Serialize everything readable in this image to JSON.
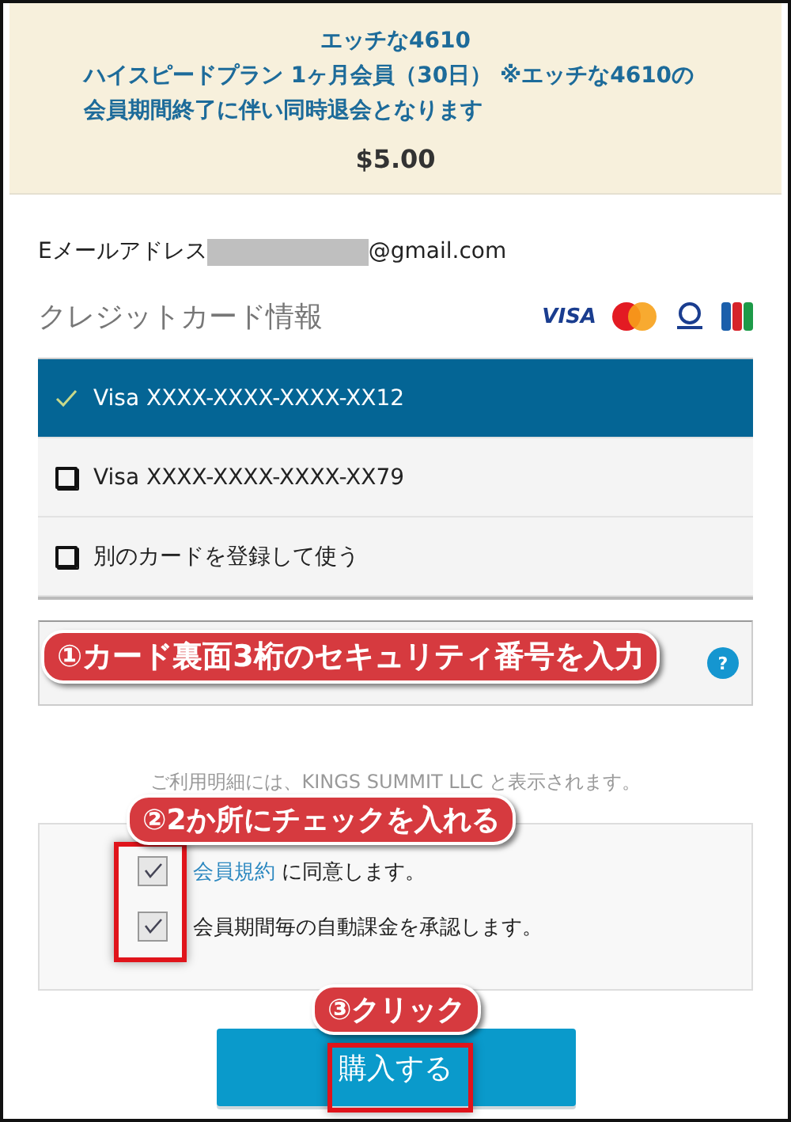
{
  "plan": {
    "title": "エッチな4610",
    "description": "ハイスピードプラン 1ヶ月会員（30日） ※エッチな4610の会員期間終了に伴い同時退会となります",
    "price": "$5.00"
  },
  "email": {
    "label": "Eメールアドレス",
    "value": "@gmail.com"
  },
  "card_section": {
    "title": "クレジットカード情報",
    "brand_text": "VISA"
  },
  "card_options": [
    {
      "label": "Visa XXXX-XXXX-XXXX-XX12",
      "selected": true
    },
    {
      "label": "Visa XXXX-XXXX-XXXX-XX79",
      "selected": false
    },
    {
      "label": "別のカードを登録して使う",
      "selected": false
    }
  ],
  "security_help": "?",
  "notice": "ご利用明細には、KINGS SUMMIT LLC と表示されます。",
  "consents": [
    {
      "link": "会員規約",
      "text": " に同意します。",
      "checked": true
    },
    {
      "text": "会員期間毎の自動課金を承認します。",
      "checked": true
    }
  ],
  "buy_button": "購入する",
  "annotations": [
    "①カード裏面3桁のセキュリティ番号を入力",
    "②2か所にチェックを入れる",
    "③クリック"
  ]
}
